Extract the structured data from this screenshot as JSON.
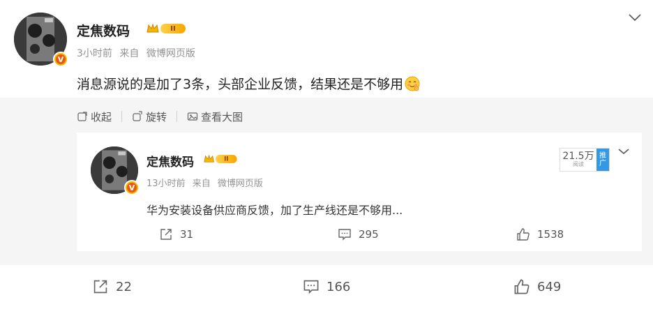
{
  "post": {
    "author": "定焦数码",
    "level_badge": "II",
    "avatar_badge": "V",
    "time": "3小时前",
    "source_prefix": "来自",
    "source": "微博网页版",
    "text": "消息源说的是加了3条，头部企业反馈，结果还是不够用",
    "toolbar": {
      "collapse": "收起",
      "rotate": "旋转",
      "view_large": "查看大图"
    },
    "stats": {
      "reposts": "22",
      "comments": "166",
      "likes": "649"
    }
  },
  "retweet": {
    "author": "定焦数码",
    "level_badge": "II",
    "avatar_badge": "V",
    "time": "13小时前",
    "source_prefix": "来自",
    "source": "微博网页版",
    "text": "华为安装设备供应商反馈，加了生产线还是不够用...",
    "promo": {
      "reads": "21.5万",
      "reads_label": "阅读",
      "tag_top": "推",
      "tag_bottom": "广"
    },
    "stats": {
      "reposts": "31",
      "comments": "295",
      "likes": "1538"
    }
  },
  "colors": {
    "text": "#333333",
    "meta": "#939393",
    "gray_bg": "#f5f5f5",
    "gold": "#f7b500",
    "promo_blue": "#3399e6"
  }
}
